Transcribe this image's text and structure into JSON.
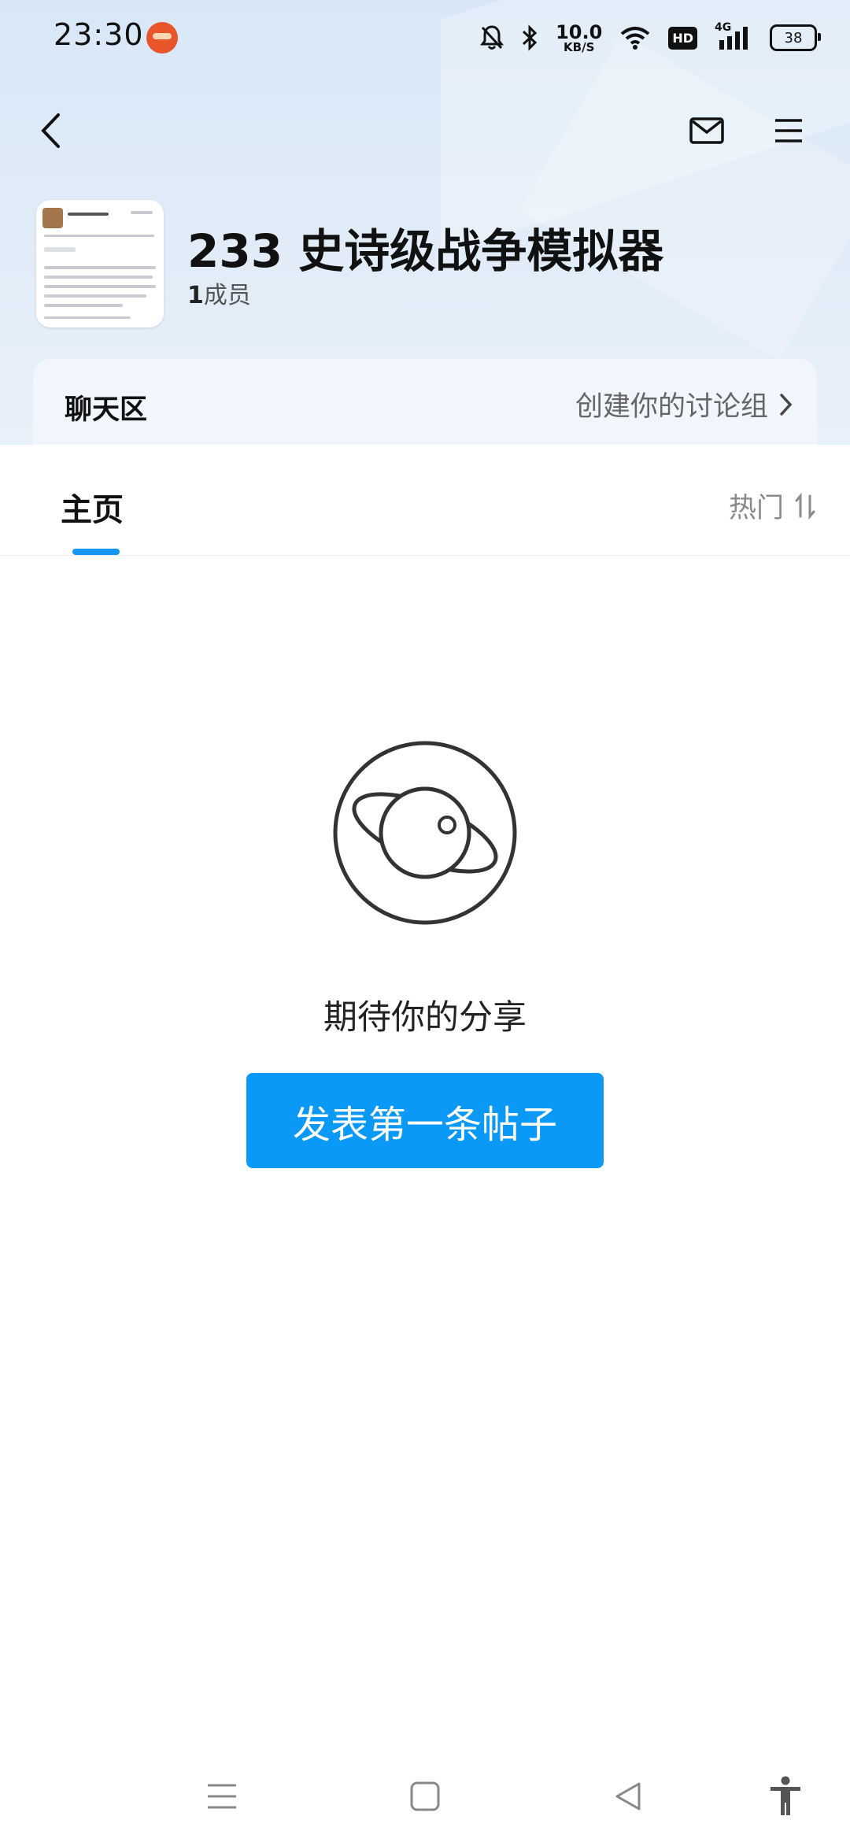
{
  "status_bar": {
    "time": "23:30",
    "net_speed_value": "10.0",
    "net_speed_unit": "KB/S",
    "hd_label": "HD",
    "signal_label": "4G",
    "battery": "38"
  },
  "header": {
    "back_icon": "chevron-left-icon",
    "mail_icon": "mail-icon",
    "menu_icon": "menu-icon"
  },
  "group": {
    "title": "233 史诗级战争模拟器",
    "member_count": "1",
    "member_suffix": "成员"
  },
  "chat_area": {
    "title": "聊天区",
    "create_label": "创建你的讨论组"
  },
  "tabs": {
    "main_label": "主页",
    "sort_label": "热门"
  },
  "empty_state": {
    "icon": "planet-icon",
    "message": "期待你的分享",
    "button_label": "发表第一条帖子"
  },
  "colors": {
    "accent": "#0a99f7",
    "tab_indicator": "#1496f1"
  }
}
